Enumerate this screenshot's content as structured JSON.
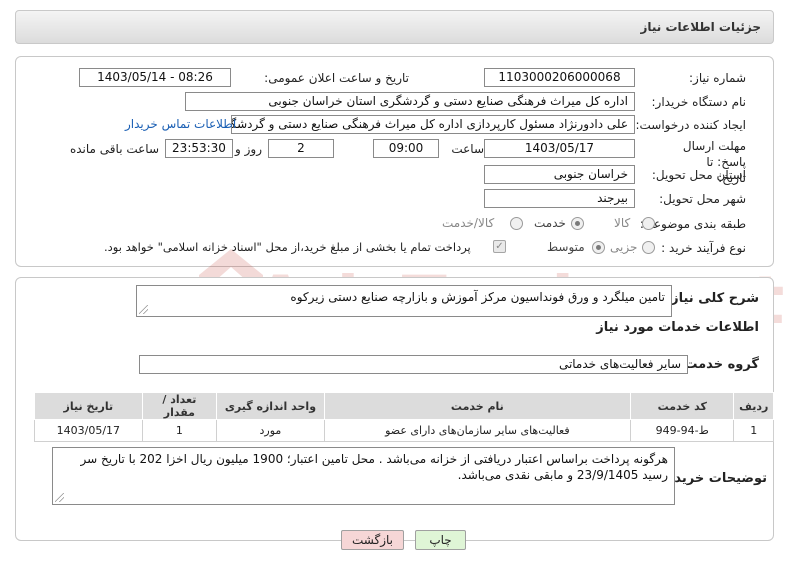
{
  "header": {
    "title": "جزئیات اطلاعات نیاز"
  },
  "form": {
    "need_number": {
      "label": "شماره نیاز:",
      "value": "1103000206000068"
    },
    "announce_datetime": {
      "label": "تاریخ و ساعت اعلان عمومی:",
      "value": "1403/05/14 - 08:26"
    },
    "buyer_org": {
      "label": "نام دستگاه خریدار:",
      "value": "اداره کل میراث فرهنگی  صنایع دستی و گردشگری استان خراسان جنوبی"
    },
    "requester": {
      "label": "ایجاد کننده درخواست:",
      "value": "علی دادورنژاد مسئول کارپردازی اداره کل میراث فرهنگی  صنایع دستی و گردشگری",
      "contact_link": "اطلاعات تماس خریدار"
    },
    "deadline": {
      "label": "مهلت ارسال پاسخ: تا تاریخ:",
      "date": "1403/05/17",
      "time_label": "ساعت",
      "time": "09:00",
      "days": "2",
      "days_label": "روز و",
      "remaining": "23:53:30",
      "remaining_label": "ساعت باقی مانده"
    },
    "province": {
      "label": "استان محل تحویل:",
      "value": "خراسان جنوبی"
    },
    "city": {
      "label": "شهر محل تحویل:",
      "value": "بیرجند"
    },
    "category": {
      "label": "طبقه بندی موضوعی:",
      "options": [
        "کالا",
        "خدمت",
        "کالا/خدمت"
      ],
      "selected": "خدمت"
    },
    "purchase_type": {
      "label": "نوع فرآیند خرید :",
      "options": [
        "جزیی",
        "متوسط"
      ],
      "selected": "متوسط",
      "note": "پرداخت تمام یا بخشی از مبلغ خرید،از محل \"اسناد خزانه اسلامی\" خواهد بود."
    }
  },
  "summary": {
    "label": "شرح کلی نیاز:",
    "value": "تامین میلگرد و ورق فونداسیون مرکز آموزش و بازارچه صنایع دستی زیرکوه"
  },
  "services": {
    "section_title": "اطلاعات خدمات مورد نیاز",
    "group_label": "گروه خدمت:",
    "group_value": "سایر فعالیت‌های خدماتی",
    "table": {
      "headers": [
        "ردیف",
        "کد خدمت",
        "نام خدمت",
        "واحد اندازه گیری",
        "تعداد / مقدار",
        "تاریخ نیاز"
      ],
      "rows": [
        [
          "1",
          "ط-94-949",
          "فعالیت‌های سایر سازمان‌های دارای عضو",
          "مورد",
          "1",
          "1403/05/17"
        ]
      ]
    }
  },
  "buyer_notes": {
    "label": "توضیحات خریدار:",
    "value": "هرگونه پرداخت براساس اعتبار دریافتی از خزانه می‌باشد . محل تامین اعتبار؛ 1900 میلیون ریال اخزا  202 با تاریخ سر رسید 23/9/1405 و مابقی نقدی می‌باشد."
  },
  "buttons": {
    "print": "چاپ",
    "back": "بازگشت"
  },
  "watermark": {
    "text": "AriaTender.net"
  },
  "colors": {
    "link": "#1a5fb4",
    "print_bg": "#dff5d6",
    "back_bg": "#f6d6d6",
    "watermark": "#c0392b"
  }
}
